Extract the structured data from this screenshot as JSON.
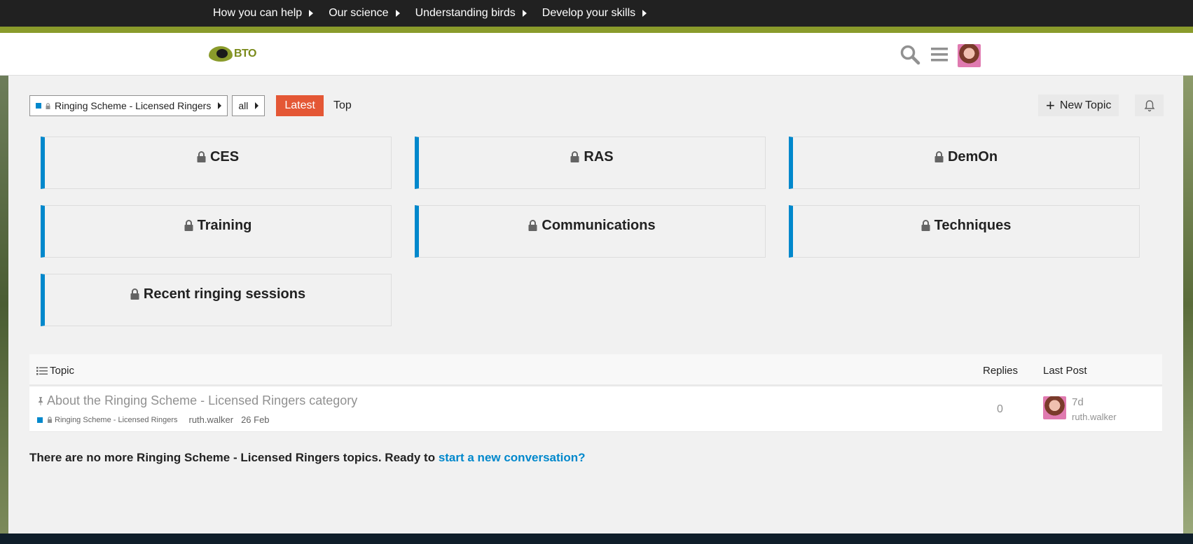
{
  "topnav": {
    "items": [
      {
        "label": "How you can help"
      },
      {
        "label": "Our science"
      },
      {
        "label": "Understanding birds"
      },
      {
        "label": "Develop your skills"
      }
    ]
  },
  "header": {
    "logo_text": "BTO",
    "search_icon": "search-icon",
    "menu_icon": "hamburger-menu-icon",
    "avatar": "user-avatar"
  },
  "controls": {
    "category_dropdown": "Ringing Scheme - Licensed Ringers",
    "subcategory_dropdown": "all",
    "tab_latest": "Latest",
    "tab_top": "Top",
    "new_topic": "New Topic",
    "accent_color": "#e45735",
    "category_color": "#0088cc"
  },
  "subcategories": [
    {
      "name": "CES"
    },
    {
      "name": "RAS"
    },
    {
      "name": "DemOn"
    },
    {
      "name": "Training"
    },
    {
      "name": "Communications"
    },
    {
      "name": "Techniques"
    },
    {
      "name": "Recent ringing sessions"
    }
  ],
  "topic_list": {
    "headers": {
      "topic": "Topic",
      "replies": "Replies",
      "last_post": "Last Post"
    },
    "rows": [
      {
        "title": "About the Ringing Scheme - Licensed Ringers category",
        "category": "Ringing Scheme - Licensed Ringers",
        "author": "ruth.walker",
        "date": "26 Feb",
        "replies": "0",
        "last_post_ago": "7d",
        "last_post_user": "ruth.walker"
      }
    ]
  },
  "footer": {
    "message": "There are no more Ringing Scheme - Licensed Ringers topics. Ready to ",
    "link": "start a new conversation?"
  }
}
